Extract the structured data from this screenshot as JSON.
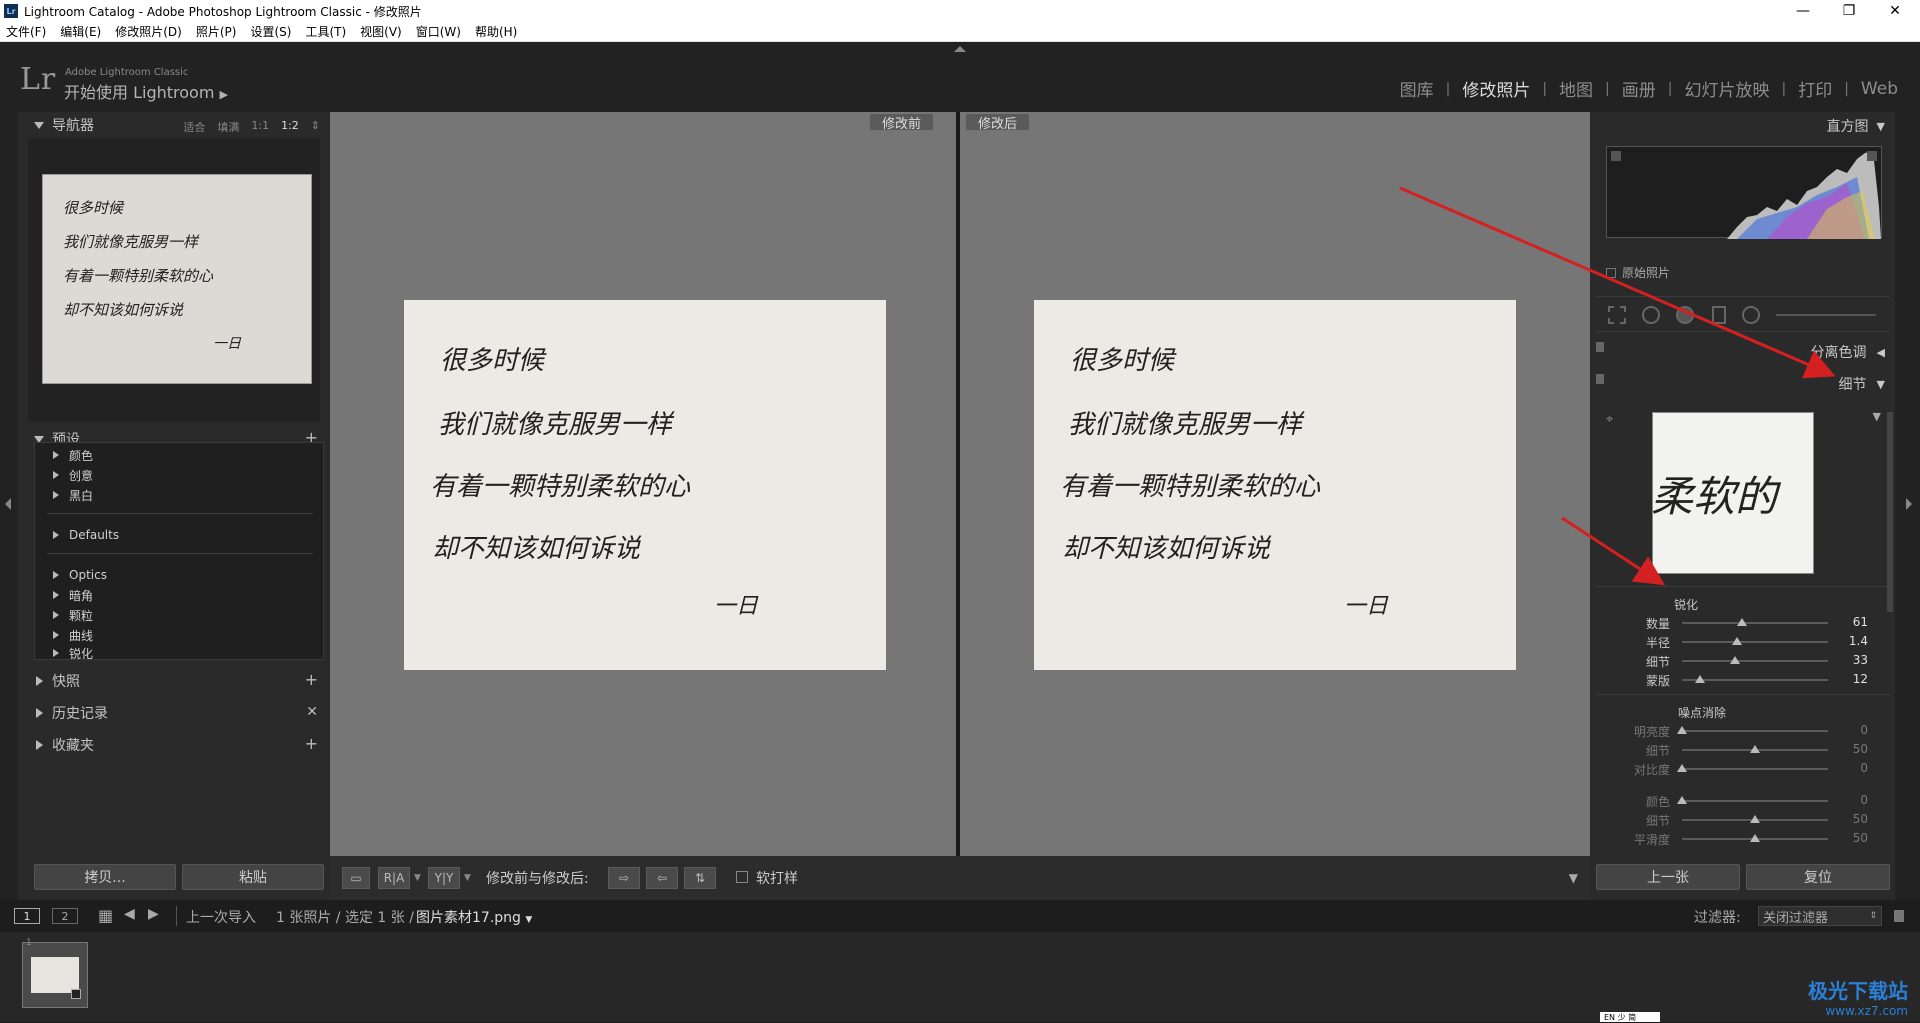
{
  "window": {
    "title": "Lightroom Catalog - Adobe Photoshop Lightroom Classic - 修改照片",
    "badge": "Lr",
    "minimize": "—",
    "maximize": "❐",
    "close": "✕"
  },
  "menu": [
    "文件(F)",
    "编辑(E)",
    "修改照片(D)",
    "照片(P)",
    "设置(S)",
    "工具(T)",
    "视图(V)",
    "窗口(W)",
    "帮助(H)"
  ],
  "brand": {
    "logo": "Lr",
    "small": "Adobe Lightroom Classic",
    "main": "开始使用 Lightroom"
  },
  "modules": [
    {
      "label": "图库",
      "active": false
    },
    {
      "label": "修改照片",
      "active": true
    },
    {
      "label": "地图",
      "active": false
    },
    {
      "label": "画册",
      "active": false
    },
    {
      "label": "幻灯片放映",
      "active": false
    },
    {
      "label": "打印",
      "active": false
    },
    {
      "label": "Web",
      "active": false
    }
  ],
  "navigator": {
    "title": "导航器",
    "options": [
      "适合",
      "填满",
      "1:1",
      "1:2"
    ],
    "selected_option": "1:2"
  },
  "presets": {
    "title": "预设",
    "groups_a": [
      "颜色",
      "创意",
      "黑白"
    ],
    "groups_b": [
      "Defaults"
    ],
    "groups_c": [
      "Optics",
      "暗角",
      "颗粒",
      "曲线",
      "锐化"
    ]
  },
  "left_sections": {
    "snapshots": "快照",
    "history": "历史记录",
    "collections": "收藏夹"
  },
  "left_buttons": {
    "copy": "拷贝...",
    "paste": "粘贴"
  },
  "view": {
    "before_label": "修改前",
    "after_label": "修改后",
    "photo_text": [
      "很多时候",
      "我们就像克服男一样",
      "有着一颗特别柔软的心",
      "却不知该如何诉说",
      "一日"
    ]
  },
  "toolbar": {
    "view_modes": [
      "R|A",
      "Y|Y"
    ],
    "before_after_label": "修改前与修改后:",
    "soft_proof_label": "软打样"
  },
  "right_panel": {
    "histogram_title": "直方图",
    "original_photo_label": "原始照片",
    "split_toning": "分离色调",
    "detail": "细节",
    "detail_preview_text": "柔软的",
    "sharpening": {
      "title": "锐化",
      "sliders": [
        {
          "label": "数量",
          "value": "61",
          "fraction": 0.41
        },
        {
          "label": "半径",
          "value": "1.4",
          "fraction": 0.38
        },
        {
          "label": "细节",
          "value": "33",
          "fraction": 0.36
        },
        {
          "label": "蒙版",
          "value": "12",
          "fraction": 0.12
        }
      ]
    },
    "noise": {
      "title": "噪点消除",
      "sliders": [
        {
          "label": "明亮度",
          "value": "0",
          "fraction": 0.0
        },
        {
          "label": "细节",
          "value": "50",
          "fraction": 0.5
        },
        {
          "label": "对比度",
          "value": "0",
          "fraction": 0.0
        }
      ],
      "color_sliders": [
        {
          "label": "颜色",
          "value": "0",
          "fraction": 0.0
        },
        {
          "label": "细节",
          "value": "50",
          "fraction": 0.5
        },
        {
          "label": "平滑度",
          "value": "50",
          "fraction": 0.5
        }
      ]
    },
    "buttons": {
      "previous": "上一张",
      "reset": "复位"
    }
  },
  "filmbar": {
    "page1": "1",
    "page2": "2",
    "source": "上一次导入",
    "info": "1 张照片 / 选定 1 张 /",
    "filename": "图片素材17.png",
    "filter_label": "过滤器:",
    "filter_value": "关闭过滤器"
  },
  "watermark": {
    "line1": "极光下载站",
    "line2": "www.xz7.com"
  },
  "ime": "EN 少 简",
  "colors": {
    "accent_arrow": "#d42020",
    "panel_bg": "#2a2a2a",
    "view_bg": "#767676"
  }
}
